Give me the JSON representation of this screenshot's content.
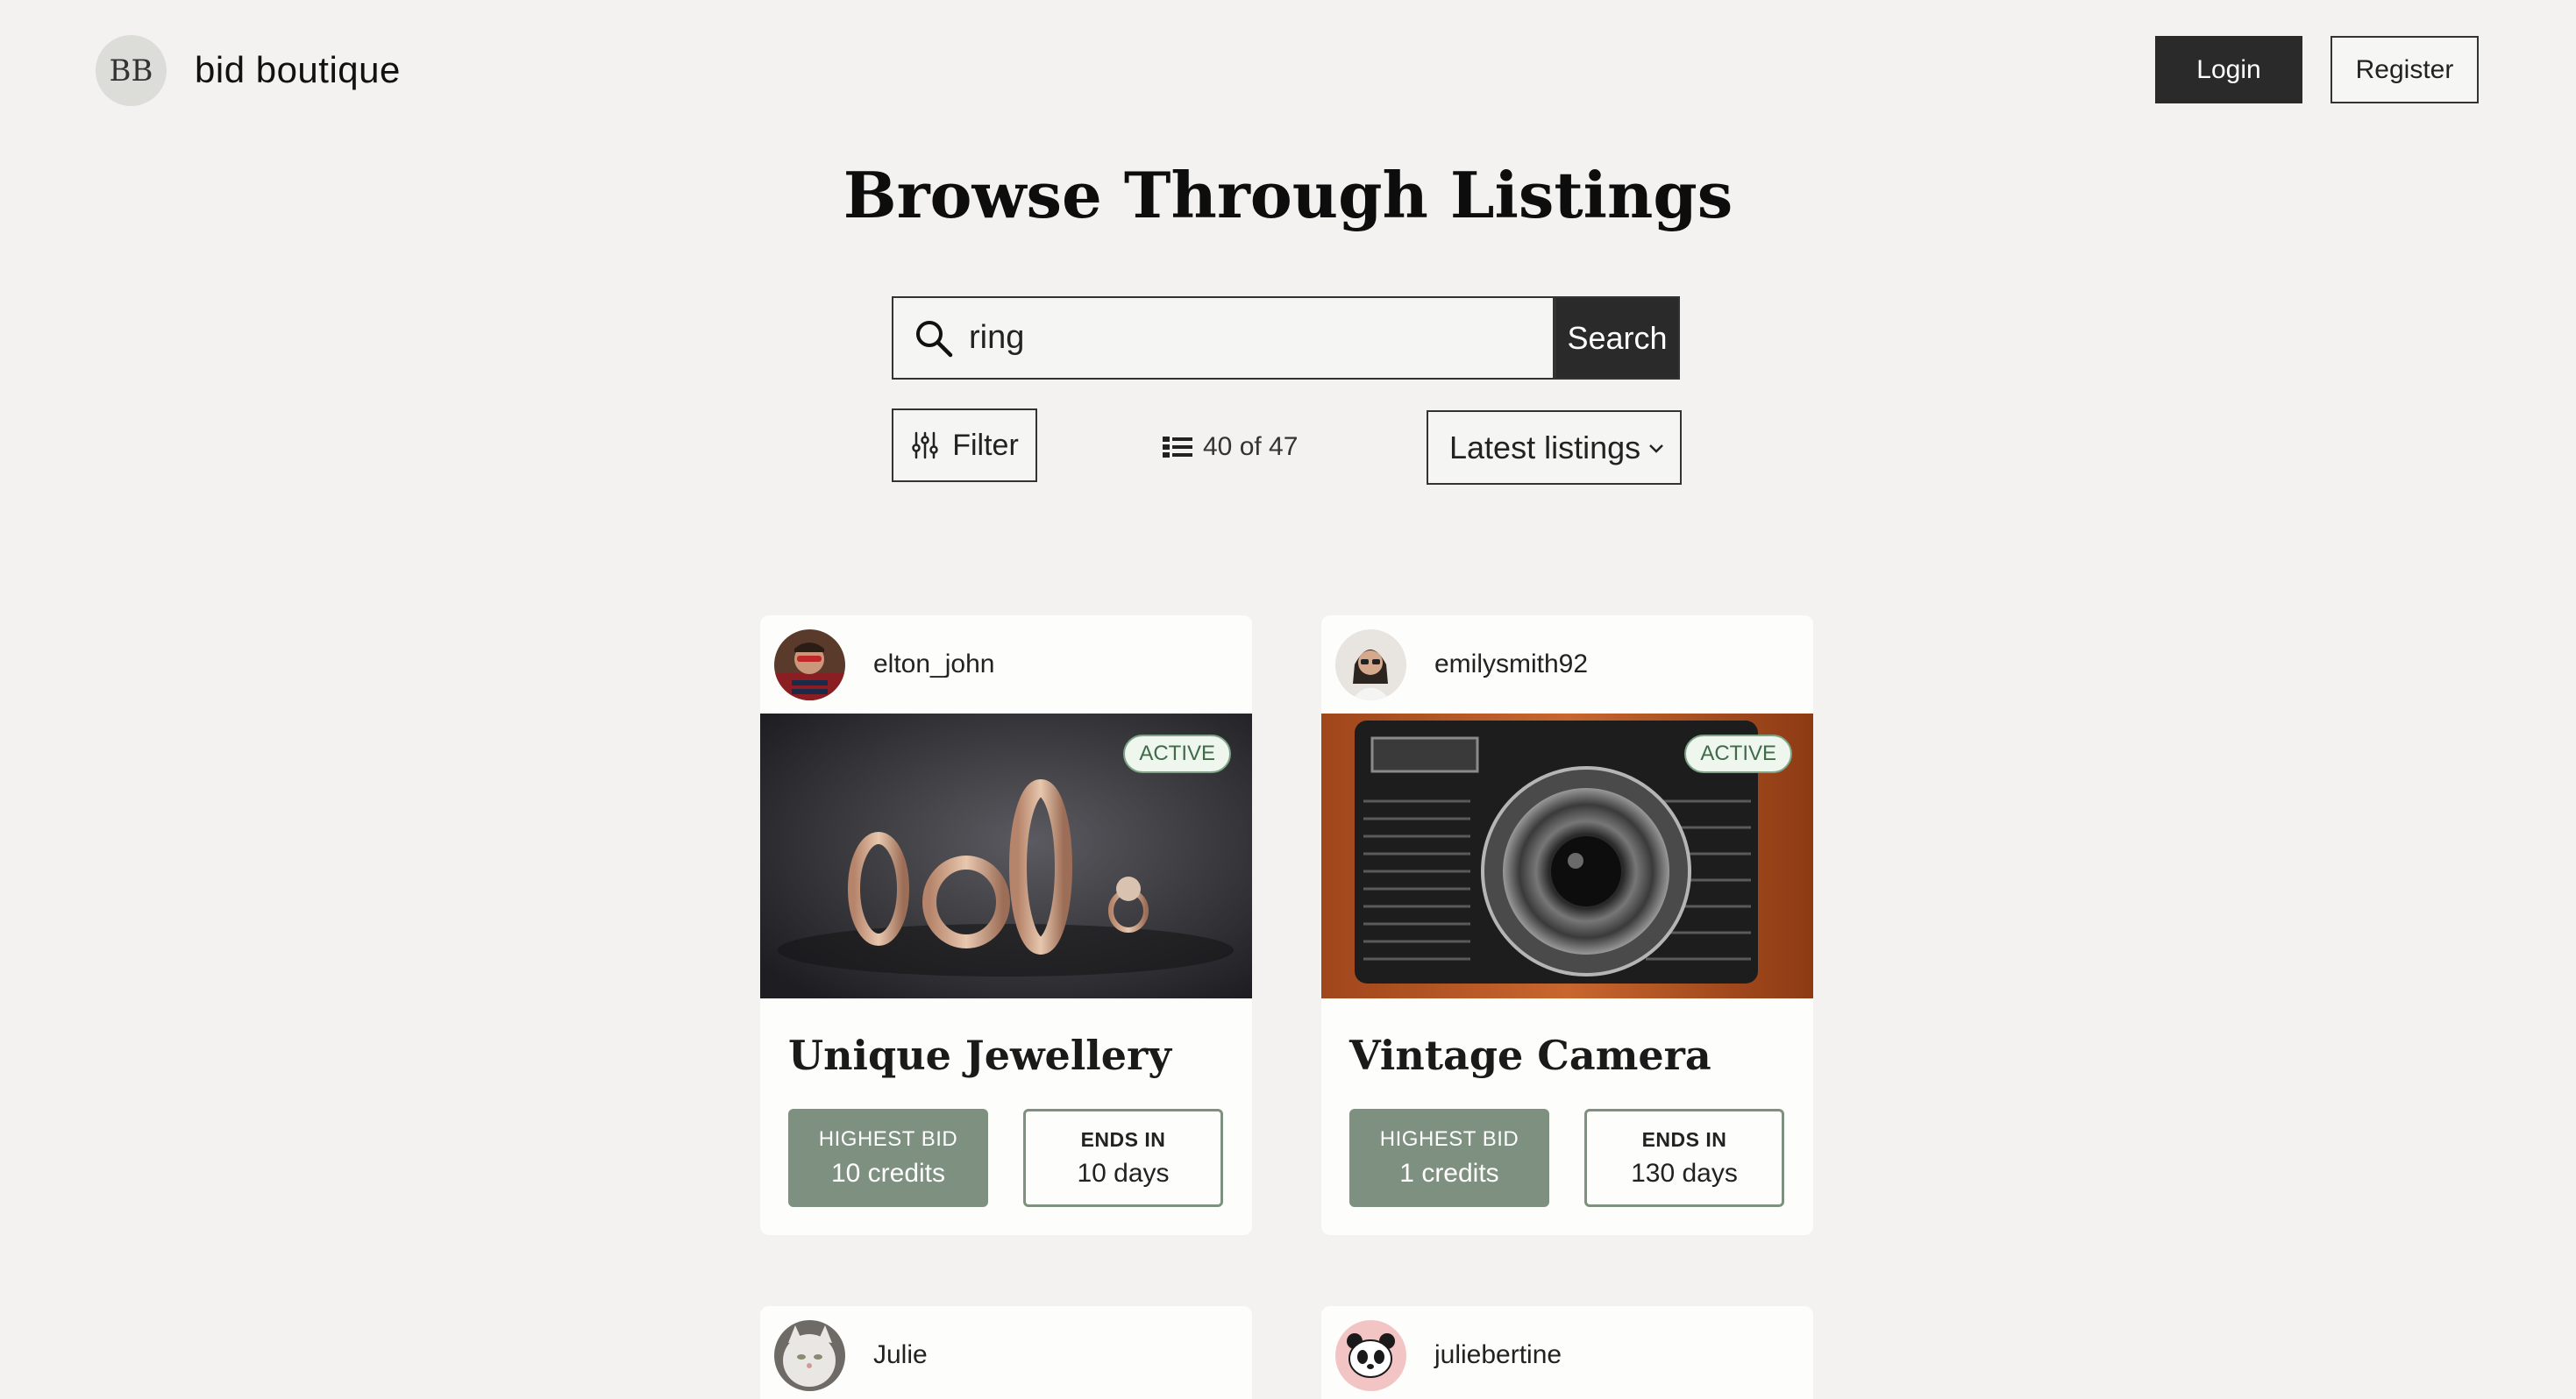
{
  "header": {
    "logo_text": "BB",
    "brand": "bid boutique",
    "login_label": "Login",
    "register_label": "Register"
  },
  "page": {
    "title": "Browse Through Listings"
  },
  "search": {
    "value": "ring",
    "button_label": "Search",
    "icon": "search-icon"
  },
  "toolbar": {
    "filter_label": "Filter",
    "count_text": "40 of 47",
    "sort_selected": "Latest listings"
  },
  "listings": [
    {
      "username": "elton_john",
      "status": "ACTIVE",
      "title": "Unique Jewellery",
      "highest_bid_label": "HIGHEST BID",
      "highest_bid_value": "10 credits",
      "ends_in_label": "ENDS IN",
      "ends_in_value": "10 days"
    },
    {
      "username": "emilysmith92",
      "status": "ACTIVE",
      "title": "Vintage Camera",
      "highest_bid_label": "HIGHEST BID",
      "highest_bid_value": "1 credits",
      "ends_in_label": "ENDS IN",
      "ends_in_value": "130 days"
    },
    {
      "username": "Julie"
    },
    {
      "username": "juliebertine"
    }
  ],
  "colors": {
    "background": "#f3f2f0",
    "dark_button": "#2a2a2a",
    "sage": "#7e907f",
    "active_badge_text": "#3f6b4a"
  }
}
